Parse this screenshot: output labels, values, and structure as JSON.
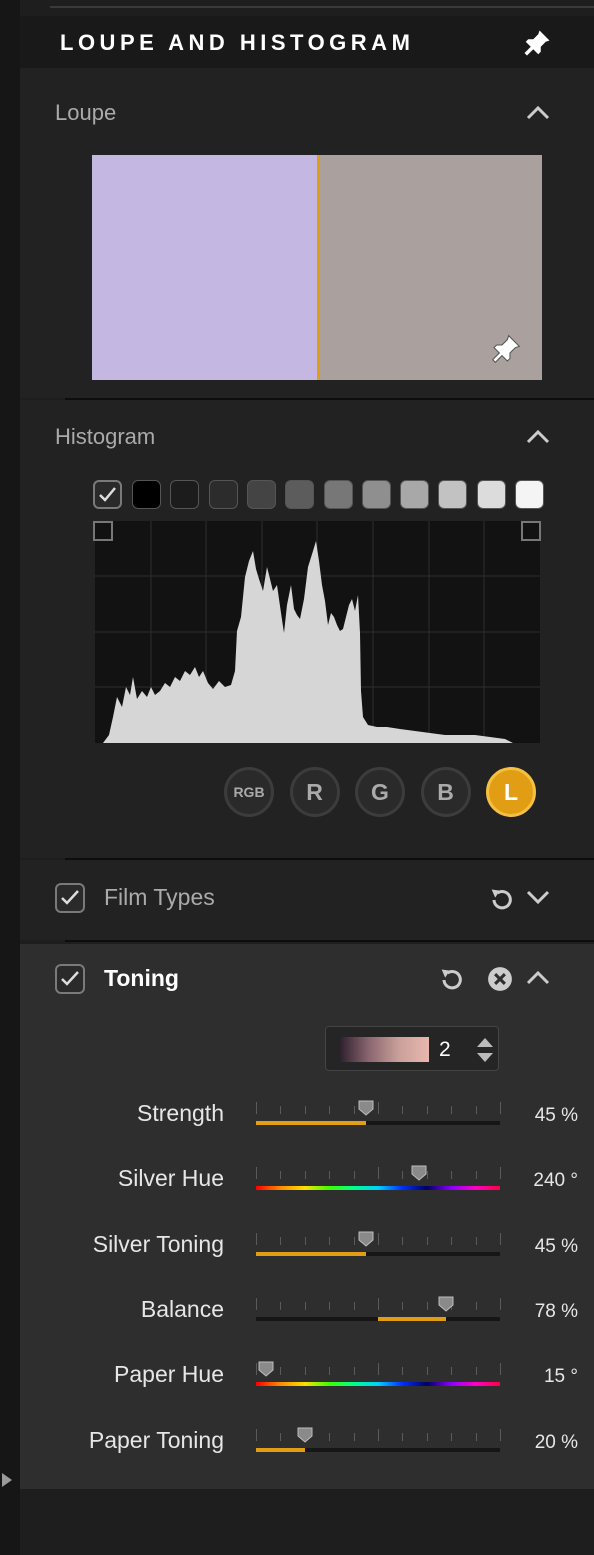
{
  "header": {
    "title": "LOUPE AND HISTOGRAM",
    "pin_icon": "pin-icon"
  },
  "loupe": {
    "label": "Loupe",
    "left_color": "#c4b7e2",
    "right_color": "#aaa19f",
    "divider_color": "#e19e15"
  },
  "histogram": {
    "label": "Histogram",
    "swatches": [
      "#000000",
      "#1c1c1c",
      "#2c2c2c",
      "#444444",
      "#5c5c5c",
      "#777777",
      "#8f8f8f",
      "#a8a8a8",
      "#c2c2c2",
      "#dcdcdc",
      "#f4f4f4"
    ],
    "channels": [
      {
        "label": "RGB",
        "active": false
      },
      {
        "label": "R",
        "active": false
      },
      {
        "label": "G",
        "active": false
      },
      {
        "label": "B",
        "active": false
      },
      {
        "label": "L",
        "active": true
      }
    ],
    "accent": "#e19e15"
  },
  "film_types": {
    "label": "Film Types",
    "checked": true
  },
  "toning": {
    "label": "Toning",
    "checked": true,
    "preset_value": "2",
    "sliders": [
      {
        "label": "Strength",
        "value_text": "45 %",
        "value": 45,
        "type": "fill"
      },
      {
        "label": "Silver Hue",
        "value_text": "240 °",
        "value": 240,
        "max": 360,
        "type": "hue"
      },
      {
        "label": "Silver Toning",
        "value_text": "45 %",
        "value": 45,
        "type": "fill"
      },
      {
        "label": "Balance",
        "value_text": "78 %",
        "value": 78,
        "type": "center"
      },
      {
        "label": "Paper Hue",
        "value_text": "15 °",
        "value": 15,
        "max": 360,
        "type": "hue"
      },
      {
        "label": "Paper Toning",
        "value_text": "20 %",
        "value": 20,
        "type": "fill"
      }
    ]
  }
}
